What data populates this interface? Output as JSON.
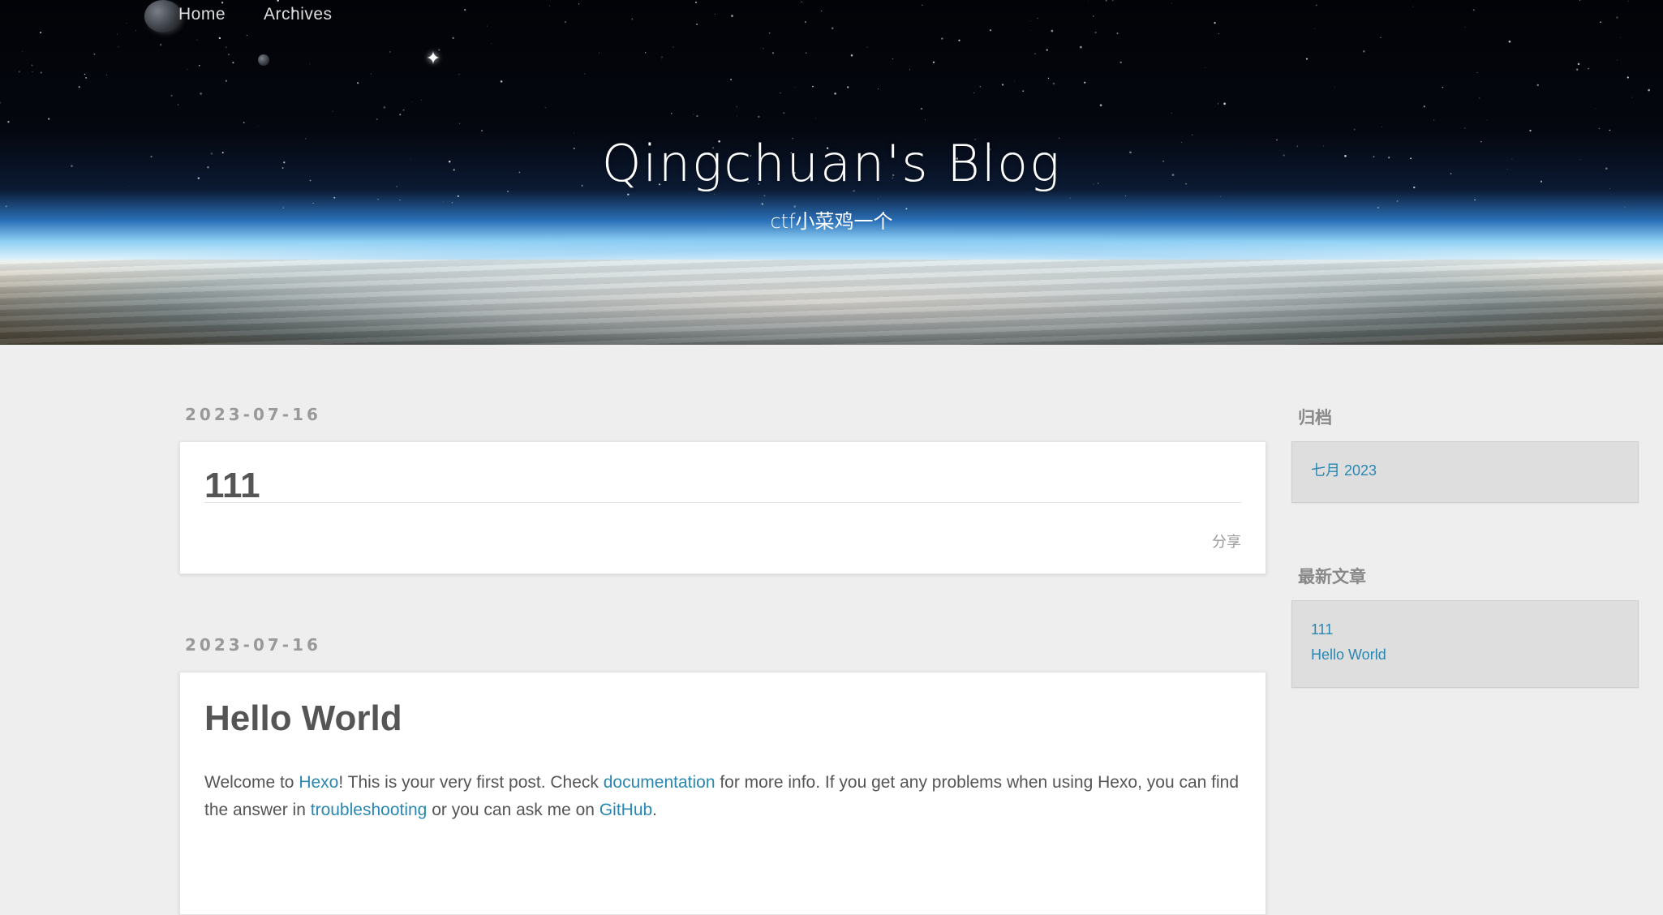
{
  "nav": {
    "items": [
      {
        "label": "Home"
      },
      {
        "label": "Archives"
      }
    ]
  },
  "header": {
    "title": "Qingchuan's Blog",
    "subtitle": "ctf小菜鸡一个"
  },
  "posts": [
    {
      "date": "2023-07-16",
      "title": "111",
      "share_label": "分享"
    },
    {
      "date": "2023-07-16",
      "title": "Hello World",
      "body": {
        "t1": "Welcome to ",
        "link_hexo": "Hexo",
        "t2": "! This is your very first post. Check ",
        "link_docs": "documentation",
        "t3": " for more info. If you get any problems when using Hexo, you can find the answer in ",
        "link_trouble": "troubleshooting",
        "t4": " or you can ask me on ",
        "link_github": "GitHub",
        "t5": "."
      }
    }
  ],
  "sidebar": {
    "archive": {
      "title": "归档",
      "items": [
        {
          "label": "七月 2023"
        }
      ]
    },
    "recent": {
      "title": "最新文章",
      "items": [
        {
          "label": "111"
        },
        {
          "label": "Hello World"
        }
      ]
    }
  },
  "colors": {
    "link": "#2a87b1",
    "background": "#eeeeee",
    "card": "#ffffff",
    "widget": "#dedede"
  },
  "icons": [
    "moon-decoration",
    "star-sparkle-icon"
  ]
}
